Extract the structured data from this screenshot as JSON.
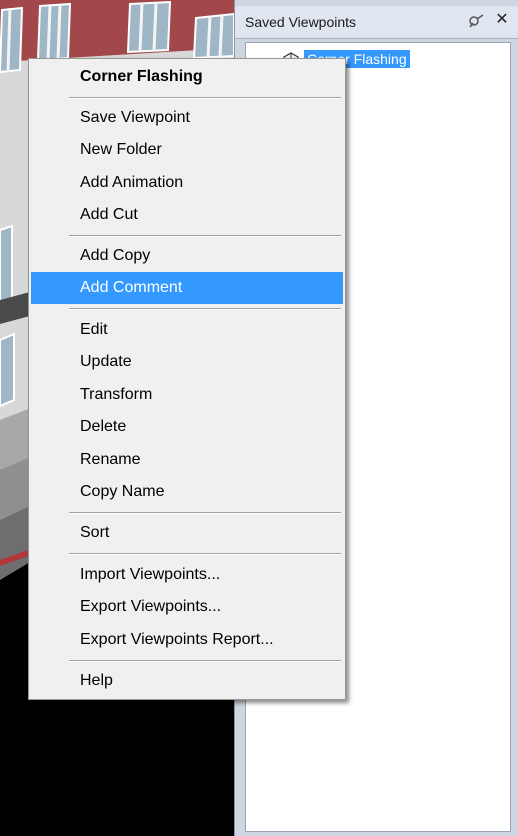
{
  "panel": {
    "title": "Saved Viewpoints",
    "pin_icon": "pin-icon",
    "close_icon": "close-icon",
    "close_glyph": "✕",
    "tree": {
      "items": [
        {
          "label": "Corner Flashing",
          "icon": "viewpoint-icon",
          "selected": true
        }
      ]
    }
  },
  "context_menu": {
    "header": "Corner Flashing",
    "groups": [
      [
        "Save Viewpoint",
        "New Folder",
        "Add Animation",
        "Add Cut"
      ],
      [
        "Add Copy",
        "Add Comment"
      ],
      [
        "Edit",
        "Update",
        "Transform",
        "Delete",
        "Rename",
        "Copy Name"
      ],
      [
        "Sort"
      ],
      [
        "Import Viewpoints...",
        "Export Viewpoints...",
        "Export Viewpoints Report..."
      ],
      [
        "Help"
      ]
    ],
    "highlighted_item": "Add Comment"
  },
  "colors": {
    "highlight": "#3399ff",
    "menu_background": "#f0f0f0",
    "panel_background": "#cdd6e2"
  }
}
